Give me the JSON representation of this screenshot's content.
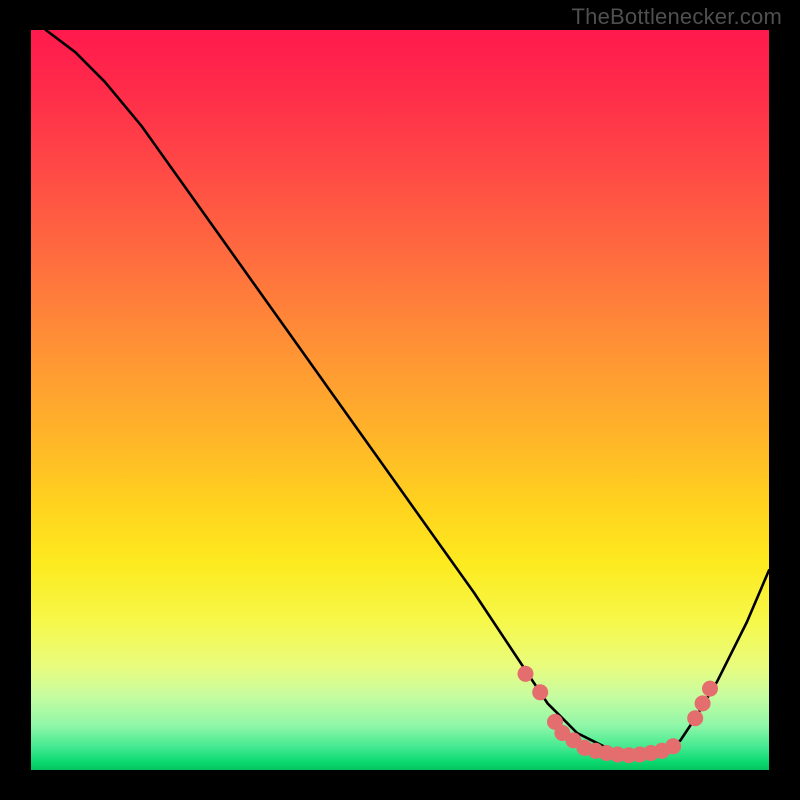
{
  "attribution": "TheBottlenecker.com",
  "chart_data": {
    "type": "line",
    "title": "",
    "xlabel": "",
    "ylabel": "",
    "xlim": [
      0,
      100
    ],
    "ylim": [
      0,
      100
    ],
    "grid": false,
    "legend": false,
    "background_gradient": {
      "orientation": "vertical",
      "stops": [
        {
          "pos": 0,
          "color": "#ff1a4d"
        },
        {
          "pos": 40,
          "color": "#ff8f36"
        },
        {
          "pos": 70,
          "color": "#ffe020"
        },
        {
          "pos": 88,
          "color": "#e7fc86"
        },
        {
          "pos": 100,
          "color": "#06c25e"
        }
      ]
    },
    "series": [
      {
        "name": "curve",
        "x": [
          2,
          6,
          10,
          15,
          20,
          25,
          30,
          35,
          40,
          45,
          50,
          55,
          60,
          64,
          68,
          70,
          72,
          74,
          76,
          78,
          80,
          82,
          84,
          86,
          88,
          90,
          93,
          97,
          100
        ],
        "y": [
          100,
          97,
          93,
          87,
          80,
          73,
          66,
          59,
          52,
          45,
          38,
          31,
          24,
          18,
          12,
          9,
          7,
          5,
          4,
          3,
          2.5,
          2,
          2,
          2.5,
          4,
          7,
          12,
          20,
          27
        ]
      }
    ],
    "markers": {
      "color": "#e46d6d",
      "radius_px": 8,
      "points": [
        {
          "x": 67,
          "y": 13
        },
        {
          "x": 69,
          "y": 10.5
        },
        {
          "x": 71,
          "y": 6.5
        },
        {
          "x": 72,
          "y": 5
        },
        {
          "x": 73.5,
          "y": 4
        },
        {
          "x": 75,
          "y": 3
        },
        {
          "x": 76.5,
          "y": 2.6
        },
        {
          "x": 78,
          "y": 2.3
        },
        {
          "x": 79.5,
          "y": 2.1
        },
        {
          "x": 81,
          "y": 2
        },
        {
          "x": 82.5,
          "y": 2.1
        },
        {
          "x": 84,
          "y": 2.3
        },
        {
          "x": 85.5,
          "y": 2.6
        },
        {
          "x": 87,
          "y": 3.2
        },
        {
          "x": 90,
          "y": 7
        },
        {
          "x": 91,
          "y": 9
        },
        {
          "x": 92,
          "y": 11
        }
      ]
    }
  }
}
